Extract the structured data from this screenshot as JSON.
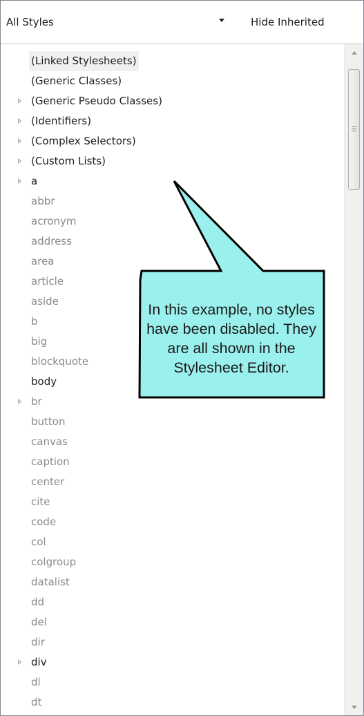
{
  "toolbar": {
    "filter_value": "All Styles",
    "hide_inherited_label": "Hide Inherited"
  },
  "tree": {
    "items": [
      {
        "label": "(Linked Stylesheets)",
        "expandable": false,
        "style": "dark",
        "selected": true
      },
      {
        "label": "(Generic Classes)",
        "expandable": false,
        "style": "dark"
      },
      {
        "label": "(Generic Pseudo Classes)",
        "expandable": true,
        "style": "dark"
      },
      {
        "label": "(Identifiers)",
        "expandable": true,
        "style": "dark"
      },
      {
        "label": "(Complex Selectors)",
        "expandable": true,
        "style": "dark"
      },
      {
        "label": "(Custom Lists)",
        "expandable": true,
        "style": "dark"
      },
      {
        "label": "a",
        "expandable": true,
        "style": "dark"
      },
      {
        "label": "abbr",
        "expandable": false,
        "style": "gray"
      },
      {
        "label": "acronym",
        "expandable": false,
        "style": "gray"
      },
      {
        "label": "address",
        "expandable": false,
        "style": "gray"
      },
      {
        "label": "area",
        "expandable": false,
        "style": "gray"
      },
      {
        "label": "article",
        "expandable": false,
        "style": "gray"
      },
      {
        "label": "aside",
        "expandable": false,
        "style": "gray"
      },
      {
        "label": "b",
        "expandable": false,
        "style": "gray"
      },
      {
        "label": "big",
        "expandable": false,
        "style": "gray"
      },
      {
        "label": "blockquote",
        "expandable": false,
        "style": "gray"
      },
      {
        "label": "body",
        "expandable": false,
        "style": "dark"
      },
      {
        "label": "br",
        "expandable": true,
        "style": "gray"
      },
      {
        "label": "button",
        "expandable": false,
        "style": "gray"
      },
      {
        "label": "canvas",
        "expandable": false,
        "style": "gray"
      },
      {
        "label": "caption",
        "expandable": false,
        "style": "gray"
      },
      {
        "label": "center",
        "expandable": false,
        "style": "gray"
      },
      {
        "label": "cite",
        "expandable": false,
        "style": "gray"
      },
      {
        "label": "code",
        "expandable": false,
        "style": "gray"
      },
      {
        "label": "col",
        "expandable": false,
        "style": "gray"
      },
      {
        "label": "colgroup",
        "expandable": false,
        "style": "gray"
      },
      {
        "label": "datalist",
        "expandable": false,
        "style": "gray"
      },
      {
        "label": "dd",
        "expandable": false,
        "style": "gray"
      },
      {
        "label": "del",
        "expandable": false,
        "style": "gray"
      },
      {
        "label": "dir",
        "expandable": false,
        "style": "gray"
      },
      {
        "label": "div",
        "expandable": true,
        "style": "dark"
      },
      {
        "label": "dl",
        "expandable": false,
        "style": "gray"
      },
      {
        "label": "dt",
        "expandable": false,
        "style": "gray"
      }
    ]
  },
  "callout": {
    "text": "In this example, no styles have been disabled. They are all shown in the Stylesheet Editor.",
    "fill_color": "#9AF0EC",
    "border_color": "#000000"
  },
  "colors": {
    "enabled_text": "#1E1E1E",
    "inherited_text": "#8A8A8A"
  },
  "icons": {
    "filter_dropdown": "chevron-down-icon",
    "tree_expander": "expand-triangle-icon",
    "scroll_up": "scroll-up-arrow-icon",
    "scroll_down": "scroll-down-arrow-icon"
  }
}
